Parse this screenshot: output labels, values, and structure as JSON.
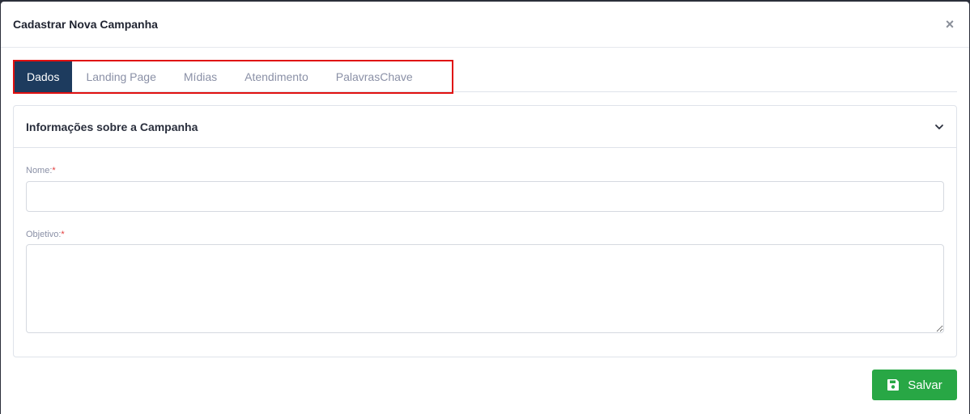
{
  "modal": {
    "title": "Cadastrar Nova Campanha",
    "close_label": "×"
  },
  "tabs": [
    {
      "label": "Dados",
      "active": true
    },
    {
      "label": "Landing Page",
      "active": false
    },
    {
      "label": "Mídias",
      "active": false
    },
    {
      "label": "Atendimento",
      "active": false
    },
    {
      "label": "PalavrasChave",
      "active": false
    }
  ],
  "section": {
    "title": "Informações sobre a Campanha",
    "icon": "chevron-down-icon"
  },
  "form": {
    "name_label": "Nome:",
    "name_required": "*",
    "name_value": "",
    "objective_label": "Objetivo:",
    "objective_required": "*",
    "objective_value": ""
  },
  "footer": {
    "save_label": "Salvar",
    "save_icon": "floppy-disk-icon"
  },
  "colors": {
    "active_tab": "#1d3b5e",
    "highlight": "#e01010",
    "save": "#28a745",
    "required": "#e33b3b"
  }
}
